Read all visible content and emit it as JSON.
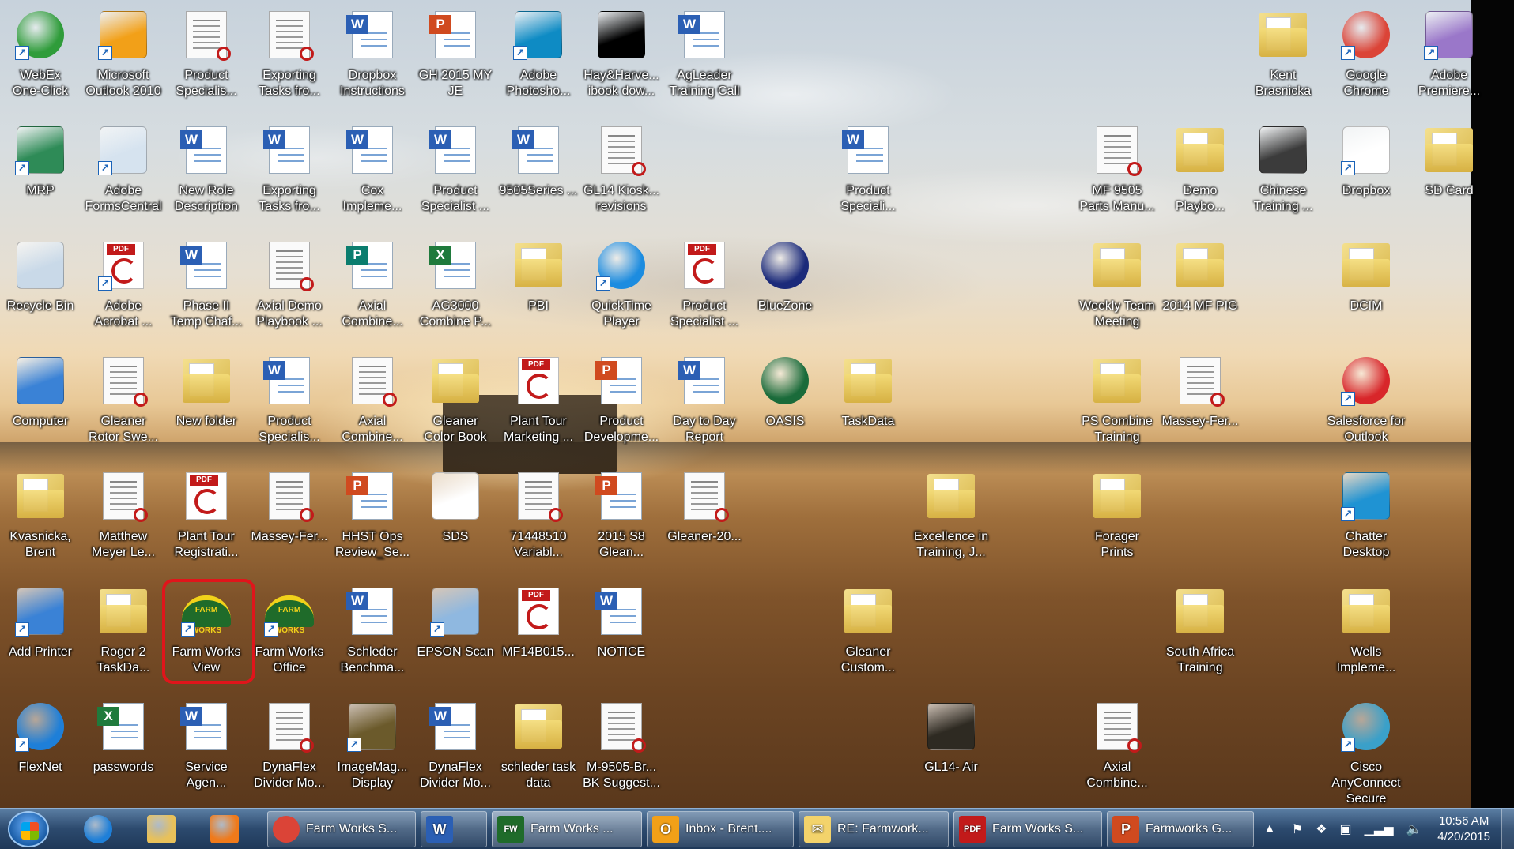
{
  "desktop": {
    "icons": [
      {
        "id": "webex",
        "label": "WebEx\nOne-Click",
        "kind": "circle",
        "color": "#2f9c3a",
        "shortcut": true
      },
      {
        "id": "outlook",
        "label": "Microsoft\nOutlook 2010",
        "kind": "box",
        "color": "#f2a018",
        "shortcut": true
      },
      {
        "id": "product-spec-1",
        "label": "Product\nSpecialis...",
        "kind": "doc",
        "shortcut": false
      },
      {
        "id": "exporting-1",
        "label": "Exporting\nTasks fro...",
        "kind": "doc",
        "shortcut": false
      },
      {
        "id": "dropbox-instr",
        "label": "Dropbox\nInstructions",
        "kind": "word",
        "shortcut": false
      },
      {
        "id": "gh2015",
        "label": "GH 2015 MY\nJE",
        "kind": "ppt",
        "shortcut": false
      },
      {
        "id": "photoshop",
        "label": "Adobe\nPhotosho...",
        "kind": "box",
        "color": "#0e8bc4",
        "shortcut": true
      },
      {
        "id": "hay",
        "label": "Hay&Harve...\nibook dow...",
        "kind": "box",
        "color": "#000000",
        "shortcut": false
      },
      {
        "id": "agleader",
        "label": "AgLeader\nTraining Call",
        "kind": "word",
        "shortcut": false
      },
      {
        "id": "kent",
        "label": "Kent\nBrasnicka",
        "kind": "folder",
        "shortcut": false
      },
      {
        "id": "chrome",
        "label": "Google\nChrome",
        "kind": "circle",
        "color": "#db4437",
        "shortcut": true
      },
      {
        "id": "premiere",
        "label": "Adobe\nPremiere...",
        "kind": "box",
        "color": "#9a77c9",
        "shortcut": true
      },
      {
        "id": "mrp",
        "label": "MRP",
        "kind": "box",
        "color": "#2e8b57",
        "shortcut": true
      },
      {
        "id": "formscentral",
        "label": "Adobe\nFormsCentral",
        "kind": "box",
        "color": "#d6e3ef",
        "shortcut": true
      },
      {
        "id": "new-role",
        "label": "New Role\nDescription",
        "kind": "word",
        "shortcut": false
      },
      {
        "id": "exporting-2",
        "label": "Exporting\nTasks fro...",
        "kind": "word",
        "shortcut": false
      },
      {
        "id": "cox",
        "label": "Cox\nImpleme...",
        "kind": "word",
        "shortcut": false
      },
      {
        "id": "product-spec-2",
        "label": "Product\nSpecialist ...",
        "kind": "word",
        "shortcut": false
      },
      {
        "id": "9505series",
        "label": "9505Series ...",
        "kind": "word",
        "shortcut": false
      },
      {
        "id": "gl14kiosk",
        "label": "GL14 Kiosk...\nrevisions",
        "kind": "doc",
        "shortcut": false
      },
      {
        "id": "product-spec-3",
        "label": "Product\nSpeciali...",
        "kind": "word",
        "shortcut": false
      },
      {
        "id": "mf9505",
        "label": "MF 9505\nParts Manu...",
        "kind": "doc",
        "shortcut": false
      },
      {
        "id": "demo-playbook",
        "label": "Demo\nPlaybo...",
        "kind": "folder",
        "shortcut": false
      },
      {
        "id": "chinese",
        "label": "Chinese\nTraining ...",
        "kind": "box",
        "color": "#3b3b3b",
        "shortcut": false
      },
      {
        "id": "dropbox",
        "label": "Dropbox",
        "kind": "box",
        "color": "#ffffff",
        "shortcut": true
      },
      {
        "id": "sdcard",
        "label": "SD Card",
        "kind": "folder",
        "shortcut": false
      },
      {
        "id": "recycle",
        "label": "Recycle Bin",
        "kind": "box",
        "color": "#c9d9e8",
        "shortcut": false
      },
      {
        "id": "acrobat",
        "label": "Adobe\nAcrobat ...",
        "kind": "pdf",
        "shortcut": true
      },
      {
        "id": "phase2",
        "label": "Phase II\nTemp Chaf...",
        "kind": "word",
        "shortcut": false
      },
      {
        "id": "axial-demo",
        "label": "Axial Demo\nPlaybook ...",
        "kind": "doc",
        "shortcut": false
      },
      {
        "id": "axial-combine-1",
        "label": "Axial\nCombine...",
        "kind": "pub",
        "shortcut": false
      },
      {
        "id": "ag3000",
        "label": "AG3000\nCombine P...",
        "kind": "excel",
        "shortcut": false
      },
      {
        "id": "pbi",
        "label": "PBI",
        "kind": "folder",
        "shortcut": false
      },
      {
        "id": "quicktime",
        "label": "QuickTime\nPlayer",
        "kind": "circle",
        "color": "#1c8ce0",
        "shortcut": true
      },
      {
        "id": "product-spec-4",
        "label": "Product\nSpecialist ...",
        "kind": "pdf",
        "shortcut": false
      },
      {
        "id": "bluezone",
        "label": "BlueZone",
        "kind": "circle",
        "color": "#1b2a7a",
        "shortcut": false
      },
      {
        "id": "weekly",
        "label": "Weekly Team\nMeeting",
        "kind": "folder",
        "shortcut": false
      },
      {
        "id": "mfpig",
        "label": "2014 MF PIG",
        "kind": "folder",
        "shortcut": false
      },
      {
        "id": "dcim",
        "label": "DCIM",
        "kind": "folder",
        "shortcut": false
      },
      {
        "id": "computer",
        "label": "Computer",
        "kind": "box",
        "color": "#3a82d6",
        "shortcut": false
      },
      {
        "id": "gleaner-rotor",
        "label": "Gleaner\nRotor Swe...",
        "kind": "doc",
        "shortcut": false
      },
      {
        "id": "new-folder",
        "label": "New folder",
        "kind": "folder",
        "shortcut": false
      },
      {
        "id": "product-spec-5",
        "label": "Product\nSpecialis...",
        "kind": "word",
        "shortcut": false
      },
      {
        "id": "axial-combine-2",
        "label": "Axial\nCombine...",
        "kind": "doc",
        "shortcut": false
      },
      {
        "id": "gleaner-colorbook",
        "label": "Gleaner\nColor Book",
        "kind": "folder",
        "shortcut": false
      },
      {
        "id": "plant-tour-mkt",
        "label": "Plant Tour\nMarketing ...",
        "kind": "pdf",
        "shortcut": false
      },
      {
        "id": "product-dev",
        "label": "Product\nDevelopme...",
        "kind": "ppt",
        "shortcut": false
      },
      {
        "id": "daytoday",
        "label": "Day to Day\nReport",
        "kind": "word",
        "shortcut": false
      },
      {
        "id": "oasis",
        "label": "OASIS",
        "kind": "circle",
        "color": "#1a6b3a",
        "shortcut": false
      },
      {
        "id": "taskdata-1",
        "label": "TaskData",
        "kind": "folder",
        "shortcut": false
      },
      {
        "id": "ps-combine",
        "label": "PS Combine\nTraining",
        "kind": "folder",
        "shortcut": false
      },
      {
        "id": "massey-1",
        "label": "Massey-Fer...",
        "kind": "doc",
        "shortcut": false
      },
      {
        "id": "salesforce",
        "label": "Salesforce for\nOutlook",
        "kind": "circle",
        "color": "#d8262a",
        "shortcut": true
      },
      {
        "id": "kvasnicka",
        "label": "Kvasnicka,\nBrent",
        "kind": "folder",
        "shortcut": false
      },
      {
        "id": "matthew",
        "label": "Matthew\nMeyer Le...",
        "kind": "doc",
        "shortcut": false
      },
      {
        "id": "plant-tour-reg",
        "label": "Plant Tour\nRegistrati...",
        "kind": "pdf",
        "shortcut": false
      },
      {
        "id": "massey-2",
        "label": "Massey-Fer...",
        "kind": "doc",
        "shortcut": false
      },
      {
        "id": "hhst",
        "label": "HHST Ops\nReview_Se...",
        "kind": "ppt",
        "shortcut": false
      },
      {
        "id": "sds",
        "label": "SDS",
        "kind": "box",
        "color": "#ffffff",
        "shortcut": false
      },
      {
        "id": "71448510",
        "label": "71448510\nVariabl...",
        "kind": "doc",
        "shortcut": false
      },
      {
        "id": "2015s8",
        "label": "2015 S8\nGlean...",
        "kind": "ppt",
        "shortcut": false
      },
      {
        "id": "gleaner-20",
        "label": "Gleaner-20...",
        "kind": "doc",
        "shortcut": false
      },
      {
        "id": "excellence",
        "label": "Excellence in\nTraining, J...",
        "kind": "folder",
        "shortcut": false
      },
      {
        "id": "forager",
        "label": "Forager\nPrints",
        "kind": "folder",
        "shortcut": false
      },
      {
        "id": "chatter",
        "label": "Chatter\nDesktop",
        "kind": "box",
        "color": "#1f93d3",
        "shortcut": true
      },
      {
        "id": "add-printer",
        "label": "Add Printer",
        "kind": "box",
        "color": "#3a82d6",
        "shortcut": true
      },
      {
        "id": "roger2",
        "label": "Roger 2\nTaskDa...",
        "kind": "folder",
        "shortcut": false
      },
      {
        "id": "farmworks-view",
        "label": "Farm Works\nView",
        "kind": "farm",
        "shortcut": true
      },
      {
        "id": "farmworks-office",
        "label": "Farm Works\nOffice",
        "kind": "farm",
        "shortcut": true
      },
      {
        "id": "schleder",
        "label": "Schleder\nBenchma...",
        "kind": "word",
        "shortcut": false
      },
      {
        "id": "epson",
        "label": "EPSON Scan",
        "kind": "box",
        "color": "#8fb8e0",
        "shortcut": true
      },
      {
        "id": "mf14b015",
        "label": "MF14B015...",
        "kind": "pdf",
        "shortcut": false
      },
      {
        "id": "notice",
        "label": "NOTICE",
        "kind": "word",
        "shortcut": false
      },
      {
        "id": "gleaner-custom",
        "label": "Gleaner\nCustom...",
        "kind": "folder",
        "shortcut": false
      },
      {
        "id": "south-africa",
        "label": "South Africa\nTraining",
        "kind": "folder",
        "shortcut": false
      },
      {
        "id": "wells",
        "label": "Wells\nImpleme...",
        "kind": "folder",
        "shortcut": false
      },
      {
        "id": "flexnet",
        "label": "FlexNet",
        "kind": "circle",
        "color": "#1e7fd8",
        "shortcut": true
      },
      {
        "id": "passwords",
        "label": "passwords",
        "kind": "excel",
        "shortcut": false
      },
      {
        "id": "service-agen",
        "label": "Service\nAgen...",
        "kind": "word",
        "shortcut": false
      },
      {
        "id": "dynaflex-1",
        "label": "DynaFlex\nDivider Mo...",
        "kind": "doc",
        "shortcut": false
      },
      {
        "id": "imagemag",
        "label": "ImageMag...\nDisplay",
        "kind": "box",
        "color": "#6b5a2b",
        "shortcut": true
      },
      {
        "id": "dynaflex-2",
        "label": "DynaFlex\nDivider Mo...",
        "kind": "word",
        "shortcut": false
      },
      {
        "id": "schleder-task",
        "label": "schleder task\ndata",
        "kind": "folder",
        "shortcut": false
      },
      {
        "id": "m9505",
        "label": "M-9505-Br...\nBK Suggest...",
        "kind": "doc",
        "shortcut": false
      },
      {
        "id": "gl14air",
        "label": "GL14- Air",
        "kind": "box",
        "color": "#2e2a22",
        "shortcut": false
      },
      {
        "id": "axial-combine-3",
        "label": "Axial\nCombine...",
        "kind": "doc",
        "shortcut": false
      },
      {
        "id": "cisco",
        "label": "Cisco\nAnyConnect\nSecure",
        "kind": "circle",
        "color": "#3aa0c9",
        "shortcut": true
      }
    ],
    "selected_icon": "farmworks-view"
  },
  "taskbar": {
    "pinned": [
      {
        "name": "internet-explorer",
        "color": "#1e7fd8"
      },
      {
        "name": "windows-explorer",
        "color": "#e8c15a"
      },
      {
        "name": "media-player",
        "color": "#f07a1a"
      }
    ],
    "windows": [
      {
        "label": "Farm Works S...",
        "icon": "chrome",
        "color": "#db4437",
        "active": false
      },
      {
        "label": "",
        "icon": "word",
        "color": "#2b5fb4",
        "active": false
      },
      {
        "label": "Farm Works ...",
        "icon": "farmworks",
        "color": "#1f6b2a",
        "active": true
      },
      {
        "label": "Inbox - Brent....",
        "icon": "outlook",
        "color": "#f2a018",
        "active": false
      },
      {
        "label": "RE: Farmwork...",
        "icon": "mail",
        "color": "#f3d36b",
        "active": false
      },
      {
        "label": "Farm Works S...",
        "icon": "pdf",
        "color": "#c21a1a",
        "active": false
      },
      {
        "label": "Farmworks G...",
        "icon": "ppt",
        "color": "#d04a1f",
        "active": false
      }
    ],
    "clock": {
      "time": "10:56 AM",
      "date": "4/20/2015"
    }
  }
}
